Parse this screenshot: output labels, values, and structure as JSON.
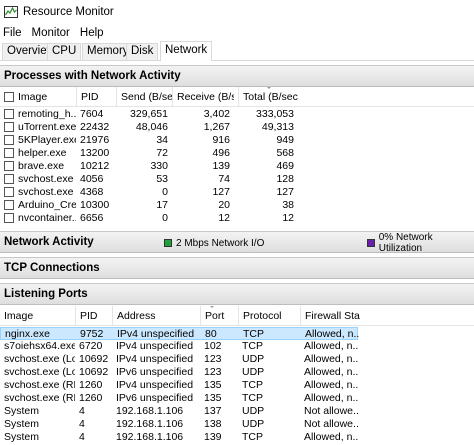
{
  "window": {
    "title": "Resource Monitor"
  },
  "menu": [
    "File",
    "Monitor",
    "Help"
  ],
  "tabs": [
    "Overview",
    "CPU",
    "Memory",
    "Disk",
    "Network"
  ],
  "processes": {
    "title": "Processes with Network Activity",
    "columns": {
      "image": "Image",
      "pid": "PID",
      "send": "Send (B/sec)",
      "receive": "Receive (B/s...",
      "total": "Total (B/sec)"
    },
    "rows": [
      {
        "image": "remoting_h...",
        "pid": "7604",
        "send": "329,651",
        "receive": "3,402",
        "total": "333,053"
      },
      {
        "image": "uTorrent.exe",
        "pid": "22432",
        "send": "48,046",
        "receive": "1,267",
        "total": "49,313"
      },
      {
        "image": "5KPlayer.exe",
        "pid": "21976",
        "send": "34",
        "receive": "916",
        "total": "949"
      },
      {
        "image": "helper.exe",
        "pid": "13200",
        "send": "72",
        "receive": "496",
        "total": "568"
      },
      {
        "image": "brave.exe",
        "pid": "10212",
        "send": "330",
        "receive": "139",
        "total": "469"
      },
      {
        "image": "svchost.exe (...",
        "pid": "4056",
        "send": "53",
        "receive": "74",
        "total": "128"
      },
      {
        "image": "svchost.exe (...",
        "pid": "4368",
        "send": "0",
        "receive": "127",
        "total": "127"
      },
      {
        "image": "Arduino_Cre...",
        "pid": "10300",
        "send": "17",
        "receive": "20",
        "total": "38"
      },
      {
        "image": "nvcontainer....",
        "pid": "6656",
        "send": "0",
        "receive": "12",
        "total": "12"
      }
    ]
  },
  "network_activity": {
    "title": "Network Activity",
    "io_label": "2 Mbps Network I/O",
    "util_label": "0% Network Utilization",
    "io_color": "#1fa03a",
    "util_color": "#6a1fa8"
  },
  "tcp": {
    "title": "TCP Connections"
  },
  "listening": {
    "title": "Listening Ports",
    "columns": {
      "image": "Image",
      "pid": "PID",
      "address": "Address",
      "port": "Port",
      "protocol": "Protocol",
      "firewall": "Firewall Sta..."
    },
    "rows": [
      {
        "image": "nginx.exe",
        "pid": "9752",
        "address": "IPv4 unspecified",
        "port": "80",
        "protocol": "TCP",
        "firewall": "Allowed, n..."
      },
      {
        "image": "s7oiehsx64.exe",
        "pid": "6720",
        "address": "IPv4 unspecified",
        "port": "102",
        "protocol": "TCP",
        "firewall": "Allowed, n..."
      },
      {
        "image": "svchost.exe (Loc...",
        "pid": "10692",
        "address": "IPv4 unspecified",
        "port": "123",
        "protocol": "UDP",
        "firewall": "Allowed, n..."
      },
      {
        "image": "svchost.exe (Loc...",
        "pid": "10692",
        "address": "IPv6 unspecified",
        "port": "123",
        "protocol": "UDP",
        "firewall": "Allowed, n..."
      },
      {
        "image": "svchost.exe (RP...",
        "pid": "1260",
        "address": "IPv4 unspecified",
        "port": "135",
        "protocol": "TCP",
        "firewall": "Allowed, n..."
      },
      {
        "image": "svchost.exe (RP...",
        "pid": "1260",
        "address": "IPv6 unspecified",
        "port": "135",
        "protocol": "TCP",
        "firewall": "Allowed, n..."
      },
      {
        "image": "System",
        "pid": "4",
        "address": "192.168.1.106",
        "port": "137",
        "protocol": "UDP",
        "firewall": "Not allowe..."
      },
      {
        "image": "System",
        "pid": "4",
        "address": "192.168.1.106",
        "port": "138",
        "protocol": "UDP",
        "firewall": "Not allowe..."
      },
      {
        "image": "System",
        "pid": "4",
        "address": "192.168.1.106",
        "port": "139",
        "protocol": "TCP",
        "firewall": "Allowed, n..."
      }
    ]
  }
}
